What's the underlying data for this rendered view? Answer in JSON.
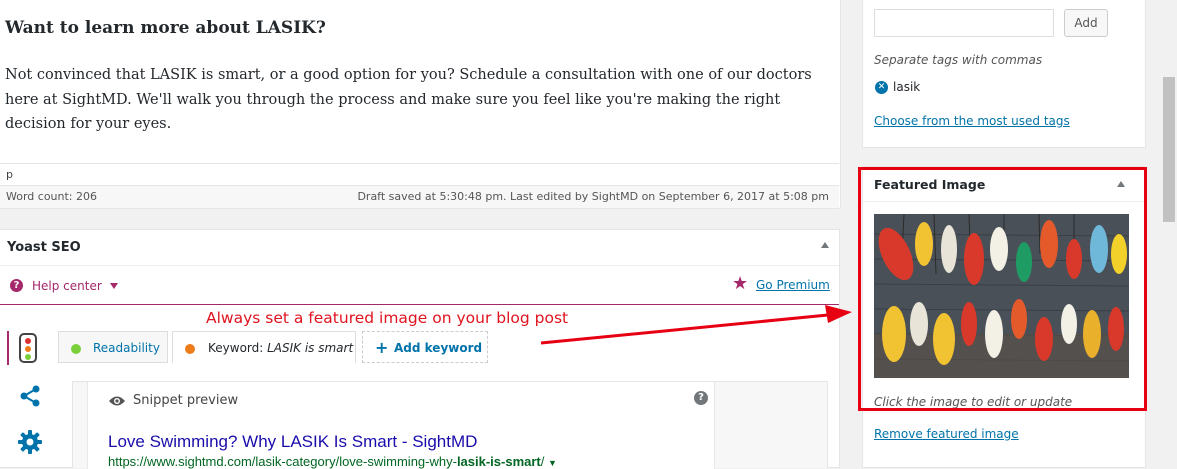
{
  "editor": {
    "heading": "Want to learn more about LASIK?",
    "paragraph": "Not convinced that LASIK is smart, or a good option for you? Schedule a consultation with one of our doctors here at SightMD. We'll walk you through the process and make sure you feel like you're making the right decision for your eyes.",
    "path": "p",
    "word_count": "Word count: 206",
    "draft_status": "Draft saved at 5:30:48 pm. Last edited by SightMD on September 6, 2017 at 5:08 pm"
  },
  "yoast": {
    "title": "Yoast SEO",
    "help_center": "Help center",
    "go_premium": "Go Premium",
    "tabs": {
      "readability": "Readability",
      "keyword_prefix": "Keyword: ",
      "keyword_value": "LASIK is smart",
      "add_keyword": "Add keyword"
    },
    "snippet": {
      "label": "Snippet preview",
      "title": "Love Swimming? Why LASIK Is Smart - SightMD",
      "url_prefix": "https://www.sightmd.com/lasik-category/love-swimming-why-",
      "url_bold": "lasik-is-smart",
      "url_suffix": "/"
    },
    "colors": {
      "brand": "#a4286a",
      "good": "#7ad03a",
      "ok": "#ee7c1b"
    }
  },
  "annotation": {
    "text": "Always set a featured image on your blog post",
    "color": "#e0141e"
  },
  "tags": {
    "add_button": "Add",
    "hint": "Separate tags with commas",
    "items": [
      "lasik"
    ],
    "choose_link": "Choose from the most used tags"
  },
  "featured_image": {
    "title": "Featured Image",
    "caption": "Click the image to edit or update",
    "remove_link": "Remove featured image"
  }
}
